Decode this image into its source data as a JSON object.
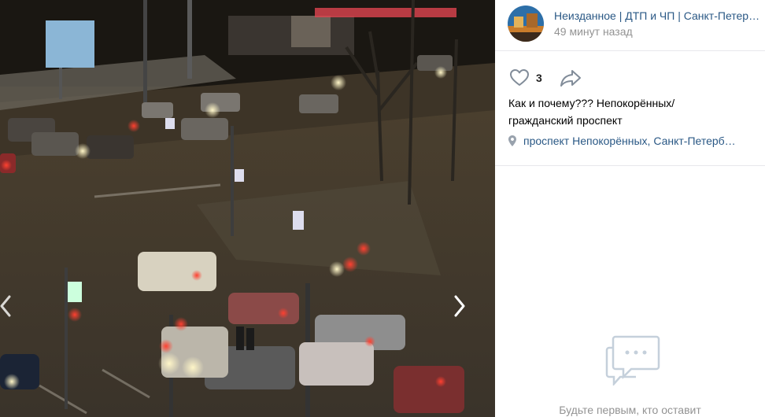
{
  "post": {
    "group_name": "Неизданное | ДТП и ЧП | Санкт-Петер…",
    "time": "49 минут назад",
    "likes": "3",
    "text_line1": "Как и почему??? Непокорённых/",
    "text_line2": "гражданский проспект",
    "location": "проспект Непокорённых, Санкт-Петерб…"
  },
  "comments": {
    "empty_text": "Будьте первым, кто оставит"
  },
  "icons": {
    "like": "heart-icon",
    "share": "share-arrow-icon",
    "location": "location-pin-icon",
    "empty_comments": "speech-bubbles-icon",
    "prev": "chevron-left-icon",
    "next": "chevron-right-icon"
  },
  "colors": {
    "link": "#2a5885",
    "muted": "#939393",
    "divider": "#e7e8ec"
  }
}
